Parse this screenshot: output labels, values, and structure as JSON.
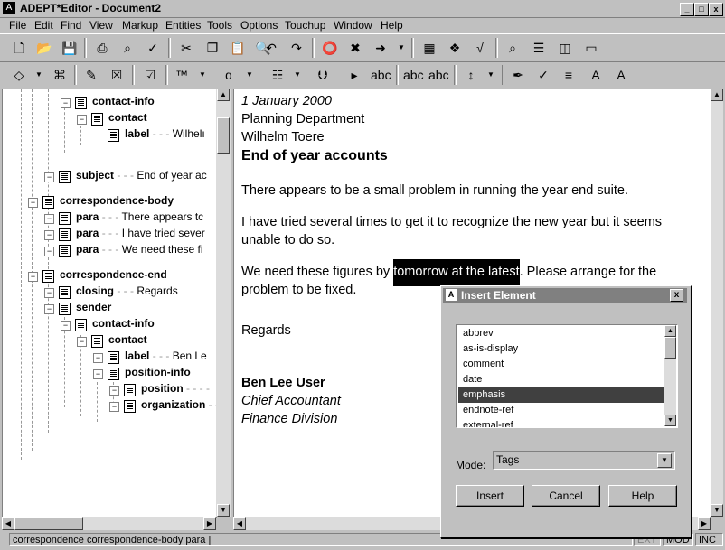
{
  "window": {
    "title": "ADEPT*Editor - Document2",
    "min": "_",
    "max": "□",
    "close": "x"
  },
  "menu": [
    "File",
    "Edit",
    "Find",
    "View",
    "Markup",
    "Entities",
    "Tools",
    "Options",
    "Touchup",
    "Window",
    "Help"
  ],
  "tree": [
    {
      "label": "contact-info",
      "value": ""
    },
    {
      "label": "contact",
      "value": ""
    },
    {
      "label": "label",
      "value": "Wilhelı"
    },
    {
      "label": "subject",
      "value": "End of year ac"
    },
    {
      "label": "correspondence-body",
      "value": ""
    },
    {
      "label": "para",
      "value": "There appears tc"
    },
    {
      "label": "para",
      "value": "I have tried sever"
    },
    {
      "label": "para",
      "value": "We need these fi"
    },
    {
      "label": "correspondence-end",
      "value": ""
    },
    {
      "label": "closing",
      "value": "Regards"
    },
    {
      "label": "sender",
      "value": ""
    },
    {
      "label": "contact-info",
      "value": ""
    },
    {
      "label": "contact",
      "value": ""
    },
    {
      "label": "label",
      "value": "Ben Le"
    },
    {
      "label": "position-info",
      "value": ""
    },
    {
      "label": "position",
      "value": ""
    },
    {
      "label": "organization",
      "value": ""
    }
  ],
  "document": {
    "date": "1 January 2000",
    "department": "Planning Department",
    "recipient": "Wilhelm Toere",
    "subject": "End of year accounts",
    "para1": "There appears to be a small problem in running the year end suite.",
    "para2_line1": "I have tried several times to get it to recognize the new year but it seems",
    "para2_line2": "unable to do so.",
    "para3_before": "We need these figures by ",
    "para3_highlight": "tomorrow at the latest",
    "para3_after": ". Please arrange for the",
    "para3_line2": "problem to be fixed.",
    "closing": "Regards",
    "sender_name": "Ben Lee User",
    "sender_position": "Chief Accountant",
    "sender_org": "Finance Division"
  },
  "dialog": {
    "title": "Insert Element",
    "items": [
      "abbrev",
      "as-is-display",
      "comment",
      "date",
      "emphasis",
      "endnote-ref",
      "external-ref"
    ],
    "selected": "emphasis",
    "mode_label": "Mode:",
    "mode_value": "Tags",
    "insert": "Insert",
    "cancel": "Cancel",
    "help": "Help",
    "close": "x"
  },
  "status": {
    "path": "correspondence correspondence-body para |",
    "ext": "EXT",
    "mod": "MOD",
    "inc": "INC"
  },
  "colors": {
    "selection": "#404040",
    "title_inactive": "#808080",
    "window_bg": "#c0c0c0"
  }
}
